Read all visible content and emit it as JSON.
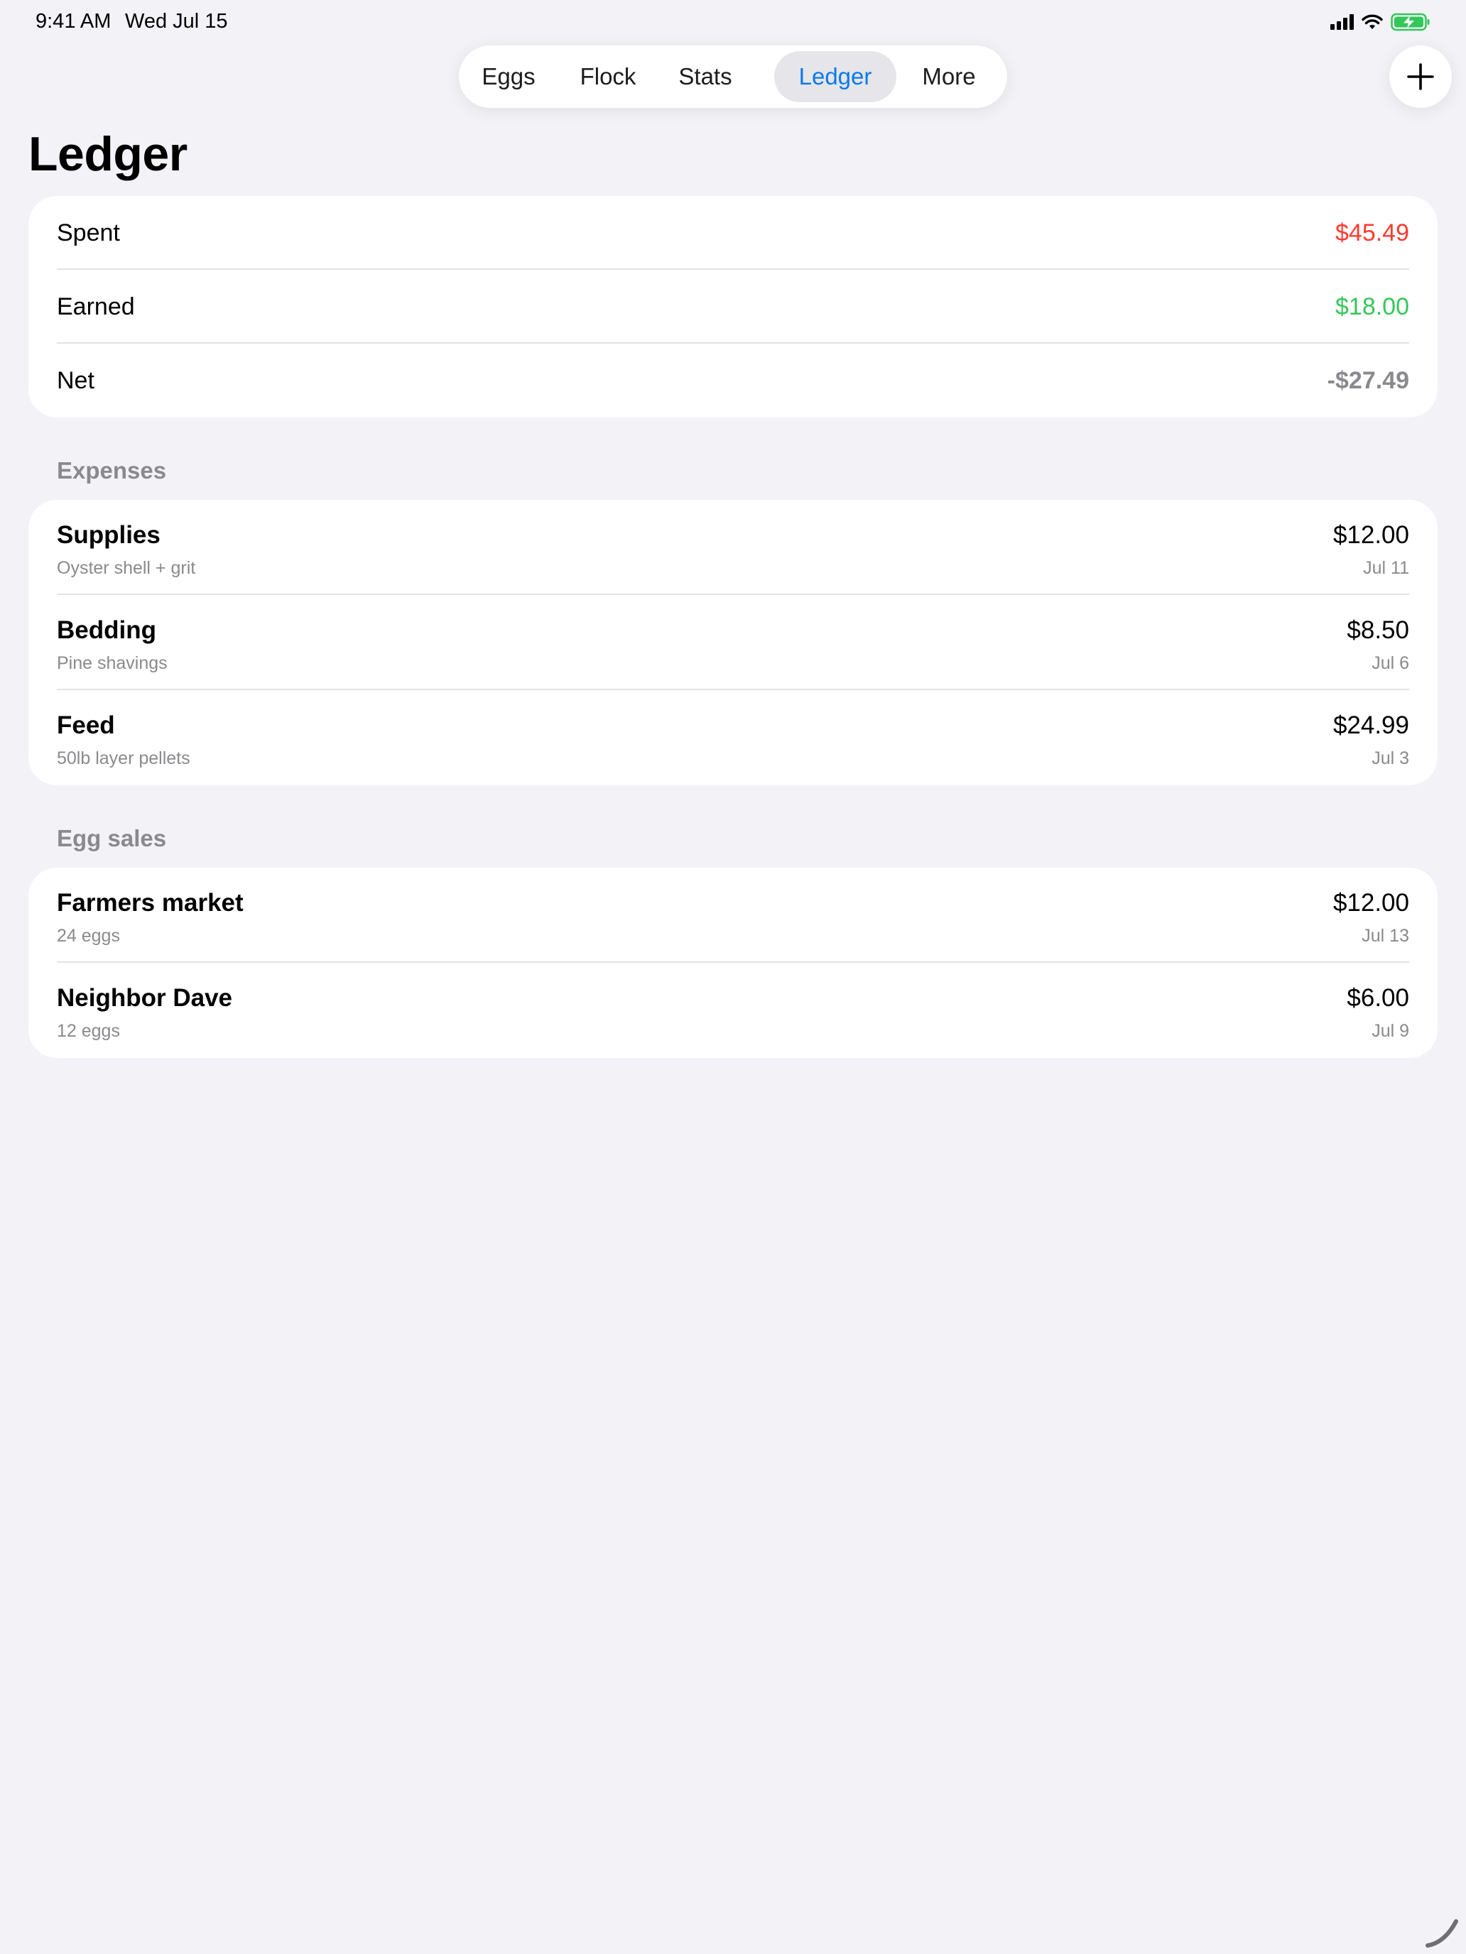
{
  "status": {
    "time": "9:41 AM",
    "date": "Wed Jul 15"
  },
  "tabs": [
    {
      "label": "Eggs",
      "active": false
    },
    {
      "label": "Flock",
      "active": false
    },
    {
      "label": "Stats",
      "active": false
    },
    {
      "label": "Ledger",
      "active": true
    },
    {
      "label": "More",
      "active": false
    }
  ],
  "page": {
    "title": "Ledger"
  },
  "summary": {
    "spent": {
      "label": "Spent",
      "value": "$45.49",
      "color": "#ff3b30"
    },
    "earned": {
      "label": "Earned",
      "value": "$18.00",
      "color": "#34c759"
    },
    "net": {
      "label": "Net",
      "value": "-$27.49",
      "color": "#8a8a8e"
    }
  },
  "expenses": {
    "header": "Expenses",
    "items": [
      {
        "title": "Supplies",
        "subtitle": "Oyster shell + grit",
        "amount": "$12.00",
        "date": "Jul 11"
      },
      {
        "title": "Bedding",
        "subtitle": "Pine shavings",
        "amount": "$8.50",
        "date": "Jul 6"
      },
      {
        "title": "Feed",
        "subtitle": "50lb layer pellets",
        "amount": "$24.99",
        "date": "Jul 3"
      }
    ]
  },
  "egg_sales": {
    "header": "Egg sales",
    "items": [
      {
        "title": "Farmers market",
        "subtitle": "24 eggs",
        "amount": "$12.00",
        "date": "Jul 13"
      },
      {
        "title": "Neighbor Dave",
        "subtitle": "12 eggs",
        "amount": "$6.00",
        "date": "Jul 9"
      }
    ]
  },
  "colors": {
    "accent": "#0a7aea",
    "background": "#f2f2f7",
    "battery": "#34c759"
  },
  "icons": [
    "cellular-signal-icon",
    "wifi-icon",
    "battery-charging-icon",
    "plus-icon"
  ]
}
